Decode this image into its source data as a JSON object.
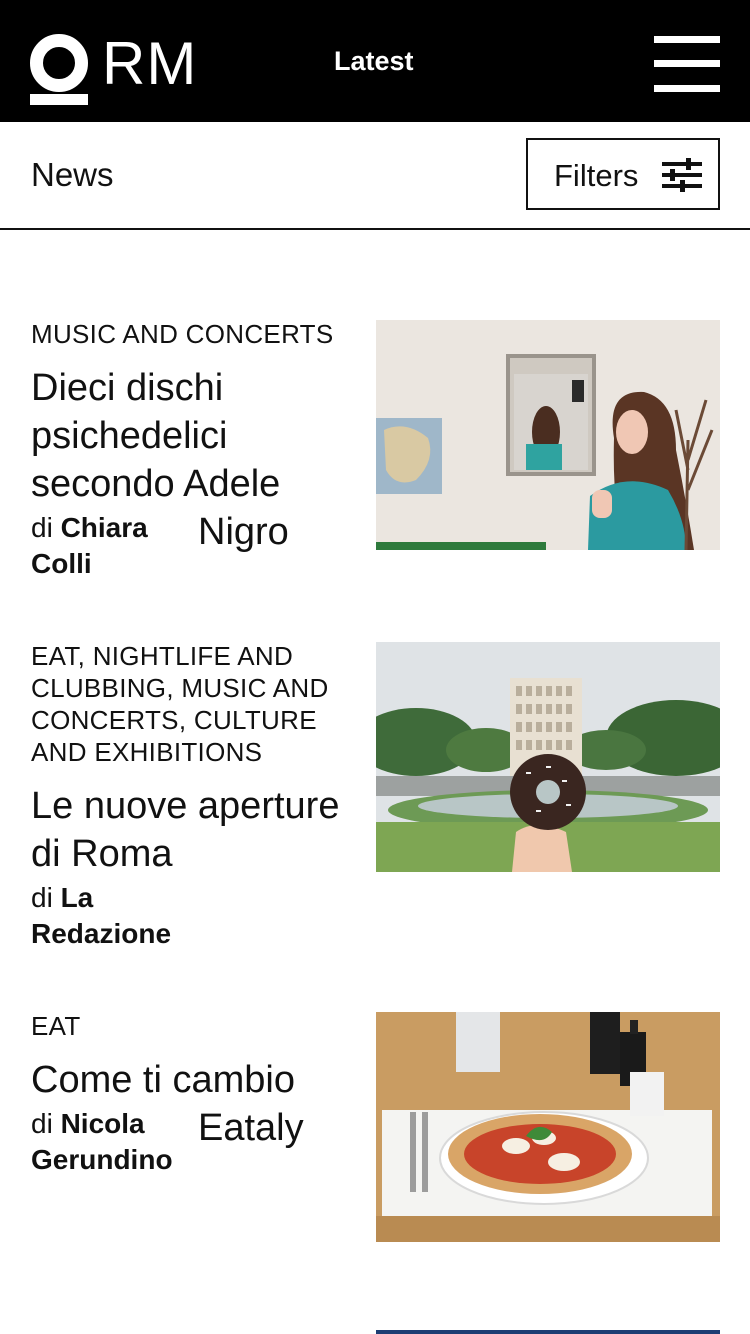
{
  "header": {
    "logo_text": "RM",
    "nav_label": "Latest",
    "menu_icon": "hamburger-menu-icon"
  },
  "subheader": {
    "title": "News",
    "filters_label": "Filters",
    "filters_icon": "sliders-icon"
  },
  "articles": [
    {
      "category": "MUSIC AND CONCERTS",
      "title": "Dieci dischi psichedelici secondo Adele",
      "title_tail": "Nigro",
      "by": "di",
      "author": "Chiara Colli"
    },
    {
      "category": "EAT, NIGHTLIFE AND CLUBBING, MUSIC AND CONCERTS, CULTURE AND EXHIBITIONS",
      "title": "Le nuove aperture di Roma",
      "by": "di",
      "author": "La Redazione"
    },
    {
      "category": "EAT",
      "title": "Come ti cambio",
      "title_tail": "Eataly",
      "by": "di",
      "author": "Nicola Gerundino"
    }
  ],
  "colors": {
    "header_bg": "#000000",
    "text": "#111111",
    "background": "#ffffff"
  }
}
